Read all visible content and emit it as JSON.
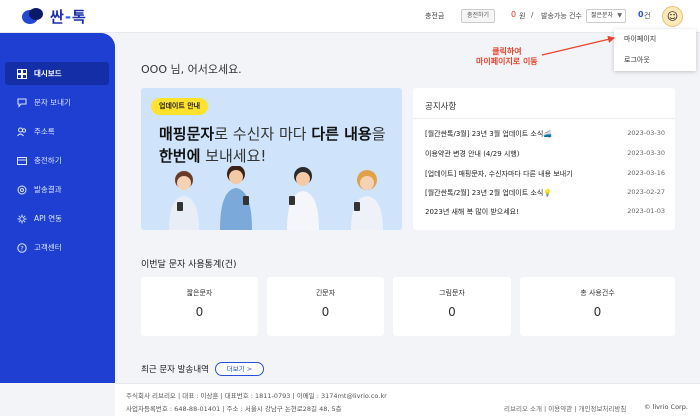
{
  "brand": {
    "name": "싼",
    "dash": "-",
    "name2": "톡"
  },
  "topbar": {
    "charge_label": "충전금",
    "charge_button": "충전하기",
    "balance": "0",
    "balance_unit": "원",
    "separator": "/",
    "sendable_label": "발송가능 건수",
    "message_type": "짧은문자",
    "sendable_count": "0",
    "sendable_unit": "건"
  },
  "dropdown": {
    "items": [
      "마이페이지",
      "로그아웃"
    ]
  },
  "callout": {
    "line1": "클릭하여",
    "line2": "마이페이지로 이동"
  },
  "sidebar": {
    "items": [
      {
        "label": "대시보드",
        "icon": "dashboard-icon",
        "active": true
      },
      {
        "label": "문자 보내기",
        "icon": "chat-icon"
      },
      {
        "label": "주소록",
        "icon": "contacts-icon"
      },
      {
        "label": "충전하기",
        "icon": "card-icon"
      },
      {
        "label": "발송결과",
        "icon": "result-icon"
      },
      {
        "label": "API 연동",
        "icon": "api-icon"
      },
      {
        "label": "고객센터",
        "icon": "help-icon"
      }
    ]
  },
  "greeting": "OOO 님, 어서오세요.",
  "banner": {
    "badge": "업데이트 안내",
    "line1_bold": "매핑문자",
    "line1_rest": "로 수신자 마다 ",
    "line1_bold2": "다른 내용",
    "line1_end": "을",
    "line2_bold": "한번에",
    "line2_rest": " 보내세요!"
  },
  "notices": {
    "title": "공지사항",
    "items": [
      {
        "text": "[월간싼톡/3월] 23년 3월 업데이트 소식🚄",
        "date": "2023-03-30"
      },
      {
        "text": "이용약관 변경 안내 (4/29 시행)",
        "date": "2023-03-30"
      },
      {
        "text": "[업데이트] 매핑문자, 수신자마다 다른 내용 보내기",
        "date": "2023-03-16"
      },
      {
        "text": "[월간싼톡/2월] 23년 2월 업데이트 소식💡",
        "date": "2023-02-27"
      },
      {
        "text": "2023년 새해 복 많이 받으세요!",
        "date": "2023-01-03"
      }
    ]
  },
  "stats": {
    "title": "이번달 문자 사용통계(건)",
    "cards": [
      {
        "label": "짧은문자",
        "value": "0"
      },
      {
        "label": "긴문자",
        "value": "0"
      },
      {
        "label": "그림문자",
        "value": "0"
      },
      {
        "label": "총 사용건수",
        "value": "0"
      }
    ]
  },
  "recent": {
    "title": "최근 문자 발송내역",
    "more": "더보기 >"
  },
  "footer": {
    "line1": "주식회사 리브리오  |  대표 : 이상훈  |  대표번호 : 1811-0793  |  이메일 : 3174mt@livrio.co.kr",
    "line2": "사업자등록번호 : 648-88-01401  |  주소 : 서울시 강남구 논현로28길 48, 5층",
    "links": "리브리오 소개  |  이용약관  |  개인정보처리방침",
    "copyright": "© livrio Corp."
  },
  "colors": {
    "sidebar": "#1e3fd1",
    "accent": "#2a50d8",
    "alert": "#e03a2f"
  }
}
